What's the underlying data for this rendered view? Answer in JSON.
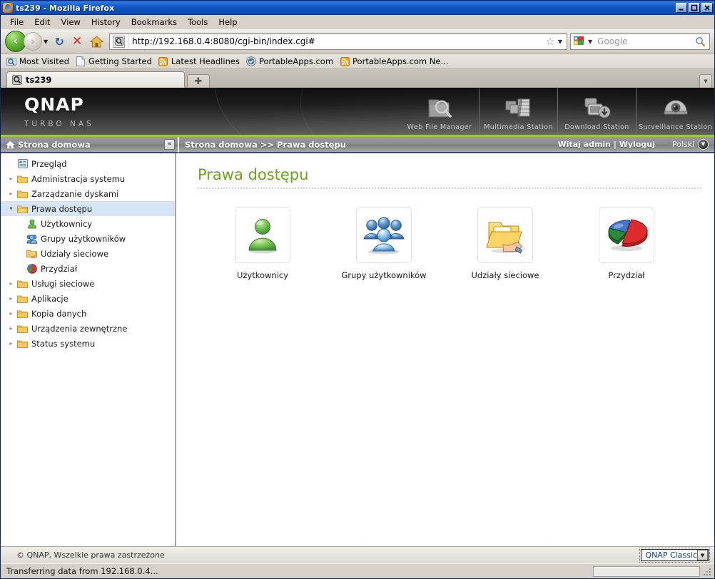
{
  "window": {
    "title": "ts239 - Mozilla Firefox",
    "minimize_label": "Minimize",
    "maximize_label": "Maximize",
    "close_label": "Close"
  },
  "menubar": [
    {
      "label": "File"
    },
    {
      "label": "Edit"
    },
    {
      "label": "View"
    },
    {
      "label": "History"
    },
    {
      "label": "Bookmarks"
    },
    {
      "label": "Tools"
    },
    {
      "label": "Help"
    }
  ],
  "toolbar": {
    "back_label": "‹",
    "forward_label": "›",
    "dropdown_caret": "▼",
    "reload_label": "↻",
    "stop_label": "✕",
    "url": "http://192.168.0.4:8080/cgi-bin/index.cgi#",
    "bookmark_star": "☆",
    "go_caret": "▼",
    "search_placeholder": "Google",
    "search_value": "",
    "search_caret": "▼"
  },
  "bookmarks": [
    {
      "label": "Most Visited",
      "icon": "most-visited-icon"
    },
    {
      "label": "Getting Started",
      "icon": "page-icon"
    },
    {
      "label": "Latest Headlines",
      "icon": "rss-icon"
    },
    {
      "label": "PortableApps.com",
      "icon": "portableapps-icon"
    },
    {
      "label": "PortableApps.com Ne...",
      "icon": "rss-icon"
    }
  ],
  "tabs": {
    "items": [
      {
        "label": "ts239",
        "active": true
      }
    ],
    "new_tab_label": "✚",
    "list_all_label": "▼"
  },
  "banner": {
    "brand": "QNAP",
    "tagline": "TURBO NAS",
    "stations": [
      {
        "label": "Web File Manager",
        "icon": "web-file-manager-icon"
      },
      {
        "label": "Multimedia Station",
        "icon": "multimedia-station-icon"
      },
      {
        "label": "Download Station",
        "icon": "download-station-icon"
      },
      {
        "label": "Surveillance Station",
        "icon": "surveillance-station-icon"
      }
    ]
  },
  "subheader": {
    "home_label": "Strona domowa",
    "collapse_label": "«",
    "breadcrumb": "Strona domowa >> Prawa dostępu",
    "welcome": "Witaj admin | Wyloguj",
    "language": "Polski",
    "language_caret": "▼"
  },
  "sidebar": {
    "items": [
      {
        "label": "Przegląd",
        "icon": "overview-icon",
        "level": 0,
        "arrow": "none",
        "selected": false
      },
      {
        "label": "Administracja systemu",
        "icon": "folder-icon",
        "level": 0,
        "arrow": "collapsed",
        "selected": false
      },
      {
        "label": "Zarządzanie dyskami",
        "icon": "folder-icon",
        "level": 0,
        "arrow": "collapsed",
        "selected": false
      },
      {
        "label": "Prawa dostępu",
        "icon": "folder-open-icon",
        "level": 0,
        "arrow": "expanded",
        "selected": true
      },
      {
        "label": "Użytkownicy",
        "icon": "user-icon",
        "level": 1,
        "arrow": "none",
        "selected": false
      },
      {
        "label": "Grupy użytkowników",
        "icon": "group-icon",
        "level": 1,
        "arrow": "none",
        "selected": false
      },
      {
        "label": "Udziały sieciowe",
        "icon": "share-icon",
        "level": 1,
        "arrow": "none",
        "selected": false
      },
      {
        "label": "Przydział",
        "icon": "quota-icon",
        "level": 1,
        "arrow": "none",
        "selected": false
      },
      {
        "label": "Usługi sieciowe",
        "icon": "folder-icon",
        "level": 0,
        "arrow": "collapsed",
        "selected": false
      },
      {
        "label": "Aplikacje",
        "icon": "folder-icon",
        "level": 0,
        "arrow": "collapsed",
        "selected": false
      },
      {
        "label": "Kopia danych",
        "icon": "folder-icon",
        "level": 0,
        "arrow": "collapsed",
        "selected": false
      },
      {
        "label": "Urządzenia zewnętrzne",
        "icon": "folder-icon",
        "level": 0,
        "arrow": "collapsed",
        "selected": false
      },
      {
        "label": "Status systemu",
        "icon": "folder-icon",
        "level": 0,
        "arrow": "collapsed",
        "selected": false
      }
    ]
  },
  "main": {
    "title": "Prawa dostępu",
    "tiles": [
      {
        "label": "Użytkownicy",
        "icon": "user-large-icon"
      },
      {
        "label": "Grupy użytkowników",
        "icon": "group-large-icon"
      },
      {
        "label": "Udziały sieciowe",
        "icon": "shared-folder-large-icon"
      },
      {
        "label": "Przydział",
        "icon": "quota-pie-large-icon"
      }
    ]
  },
  "page_footer": {
    "copyright": "© QNAP, Wszelkie prawa zastrzeżone",
    "theme": "QNAP Classic",
    "theme_caret": "▼"
  },
  "status_bar": {
    "text": "Transferring data from 192.168.0.4..."
  },
  "colors": {
    "accent_green": "#9ac93a",
    "title_green": "#6aa51b",
    "titlebar_blue": "#0a49b5",
    "selection_blue": "#d6e5f5",
    "chrome_gray": "#d6d2ca"
  }
}
